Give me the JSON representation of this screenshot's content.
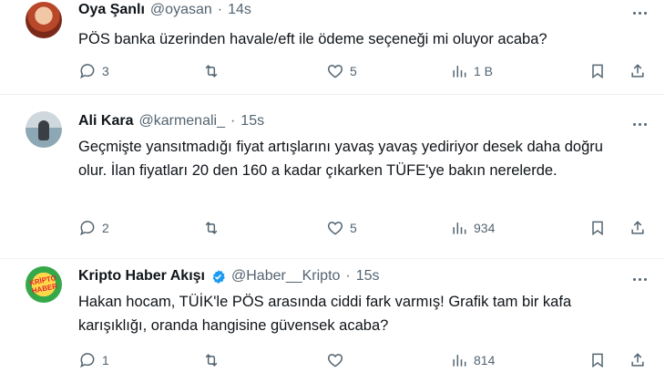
{
  "tweets": [
    {
      "name": "Oya Şanlı",
      "handle": "@oyasan",
      "time": "14s",
      "text": "PÖS banka üzerinden havale/eft ile ödeme seçeneği mi oluyor acaba?",
      "replies": "3",
      "likes": "5",
      "views": "1 B",
      "verified": false
    },
    {
      "name": "Ali Kara",
      "handle": "@karmenali_",
      "time": "15s",
      "text": "Geçmişte yansıtmadığı fiyat artışlarını yavaş yavaş yediriyor desek daha doğru olur. İlan fiyatları 20 den 160 a kadar çıkarken TÜFE'ye bakın nerelerde.",
      "replies": "2",
      "likes": "5",
      "views": "934",
      "verified": false
    },
    {
      "name": "Kripto Haber Akışı",
      "handle": "@Haber__Kripto",
      "time": "15s",
      "text": "Hakan hocam, TÜİK'le PÖS arasında ciddi fark varmış! Grafik tam bir kafa karışıklığı, oranda hangisine güvensek acaba?",
      "replies": "1",
      "likes": "",
      "views": "814",
      "verified": true,
      "avatar_text": "KRİPTO HABER"
    }
  ],
  "separator": "·",
  "colors": {
    "verified": "#1d9bf0",
    "muted": "#536471",
    "text": "#0f1419"
  }
}
